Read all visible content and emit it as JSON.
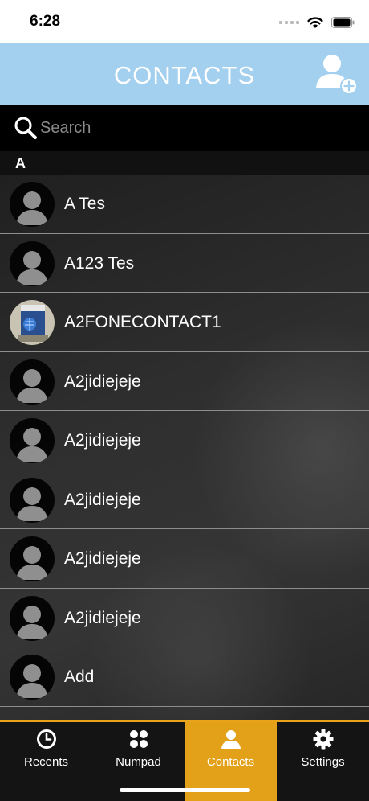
{
  "status": {
    "time": "6:28"
  },
  "header": {
    "title": "CONTACTS",
    "add_icon": "add-contact-icon"
  },
  "search": {
    "placeholder": "Search",
    "value": ""
  },
  "section": {
    "letter": "A"
  },
  "contacts": [
    {
      "name": "A Tes",
      "avatar": "default"
    },
    {
      "name": "A123 Tes",
      "avatar": "default"
    },
    {
      "name": "A2FONECONTACT1",
      "avatar": "photo"
    },
    {
      "name": "A2jidiejeje",
      "avatar": "default"
    },
    {
      "name": "A2jidiejeje",
      "avatar": "default"
    },
    {
      "name": "A2jidiejeje",
      "avatar": "default"
    },
    {
      "name": "A2jidiejeje",
      "avatar": "default"
    },
    {
      "name": "A2jidiejeje",
      "avatar": "default"
    },
    {
      "name": "Add",
      "avatar": "default"
    }
  ],
  "tabs": [
    {
      "label": "Recents",
      "icon": "clock-icon",
      "active": false
    },
    {
      "label": "Numpad",
      "icon": "numpad-icon",
      "active": false
    },
    {
      "label": "Contacts",
      "icon": "person-icon",
      "active": true
    },
    {
      "label": "Settings",
      "icon": "gear-icon",
      "active": false
    }
  ],
  "colors": {
    "header": "#a3d0ee",
    "accent": "#e3a019",
    "tabbar": "#141414"
  }
}
